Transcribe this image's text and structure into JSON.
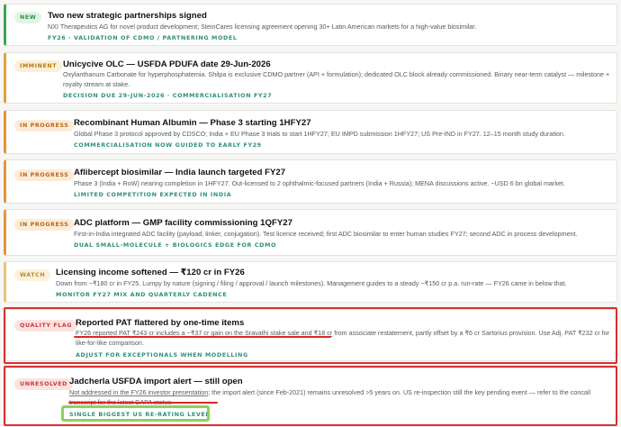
{
  "items": [
    {
      "badge": "NEW",
      "title": "Two new strategic partnerships signed",
      "body": "NXI Therapeutics AG for novel product development; SteinCares licensing agreement opening 30+ Latin American markets for a high-value biosimilar.",
      "footer": "FY26 · VALIDATION OF CDMO / PARTNERING MODEL",
      "accent": "#3aa655"
    },
    {
      "badge": "IMMINENT",
      "title": "Unicycive OLC — USFDA PDUFA date 29-Jun-2026",
      "body": "Oxylanthanum Carbonate for hyperphosphatemia. Shilpa is exclusive CDMO partner (API + formulation); dedicated OLC block already commissioned. Binary near-term catalyst — milestone + royalty stream at stake.",
      "footer": "DECISION DUE 29-JUN-2026 · COMMERCIALISATION FY27",
      "accent": "#e2a13a"
    },
    {
      "badge": "IN PROGRESS",
      "title": "Recombinant Human Albumin — Phase 3 starting 1HFY27",
      "body": "Global Phase 3 protocol approved by CDSCO; India + EU Phase 3 trials to start 1HFY27; EU IMPD submission 1HFY27; US Pre-IND in FY27. 12–15 month study duration.",
      "footer": "COMMERCIALISATION NOW GUIDED TO EARLY FY29",
      "accent": "#e8943a"
    },
    {
      "badge": "IN PROGRESS",
      "title": "Aflibercept biosimilar — India launch targeted FY27",
      "body": "Phase 3 (India + RoW) nearing completion in 1HFY27. Out-licensed to 2 ophthalmic-focused partners (India + Russia); MENA discussions active. ~USD 6 bn global market.",
      "footer": "LIMITED COMPETITION EXPECTED IN INDIA",
      "accent": "#e8943a"
    },
    {
      "badge": "IN PROGRESS",
      "title": "ADC platform — GMP facility commissioning 1QFY27",
      "body": "First-in-India integrated ADC facility (payload, linker, conjugation). Test licence received; first ADC biosimilar to enter human studies FY27; second ADC in process development.",
      "footer": "DUAL SMALL-MOLECULE + BIOLOGICS EDGE FOR CDMO",
      "accent": "#e8943a"
    },
    {
      "badge": "WATCH",
      "title": "Licensing income softened — ₹120 cr in FY26",
      "body": "Down from ~₹180 cr in FY25. Lumpy by nature (signing / filing / approval / launch milestones). Management guides to a steady ~₹150 cr p.a. run-rate — FY26 came in below that.",
      "footer": "MONITOR FY27 MIX AND QUARTERLY CADENCE",
      "accent": "#e8c27a"
    },
    {
      "badge": "QUALITY FLAG",
      "title": "Reported PAT flattered by one-time items",
      "body_underlined": "FY26 reported PAT ₹243 cr includes a ~₹37 cr gain on the Sravathi stake sale and ₹18 cr",
      "body_rest": " from associate restatement, partly offset by a ₹6 cr Sartorius provision. Use Adj. PAT ₹232 cr for like-for-like comparison.",
      "footer": "ADJUST FOR EXCEPTIONALS WHEN MODELLING",
      "accent": "#e0e0dc"
    },
    {
      "badge": "UNRESOLVED",
      "title": "Jadcherla USFDA import alert — still open",
      "body_underlined": "Not addressed in the FY26 investor presentation",
      "body_rest": "; the import alert (since Feb-2021) remains unresolved >5 years on. US re-inspection still the key pending event — refer to the concall transcript for the latest CAPA status.",
      "footer": "SINGLE BIGGEST US RE-RATING LEVER",
      "accent": "#e0e0dc"
    }
  ]
}
